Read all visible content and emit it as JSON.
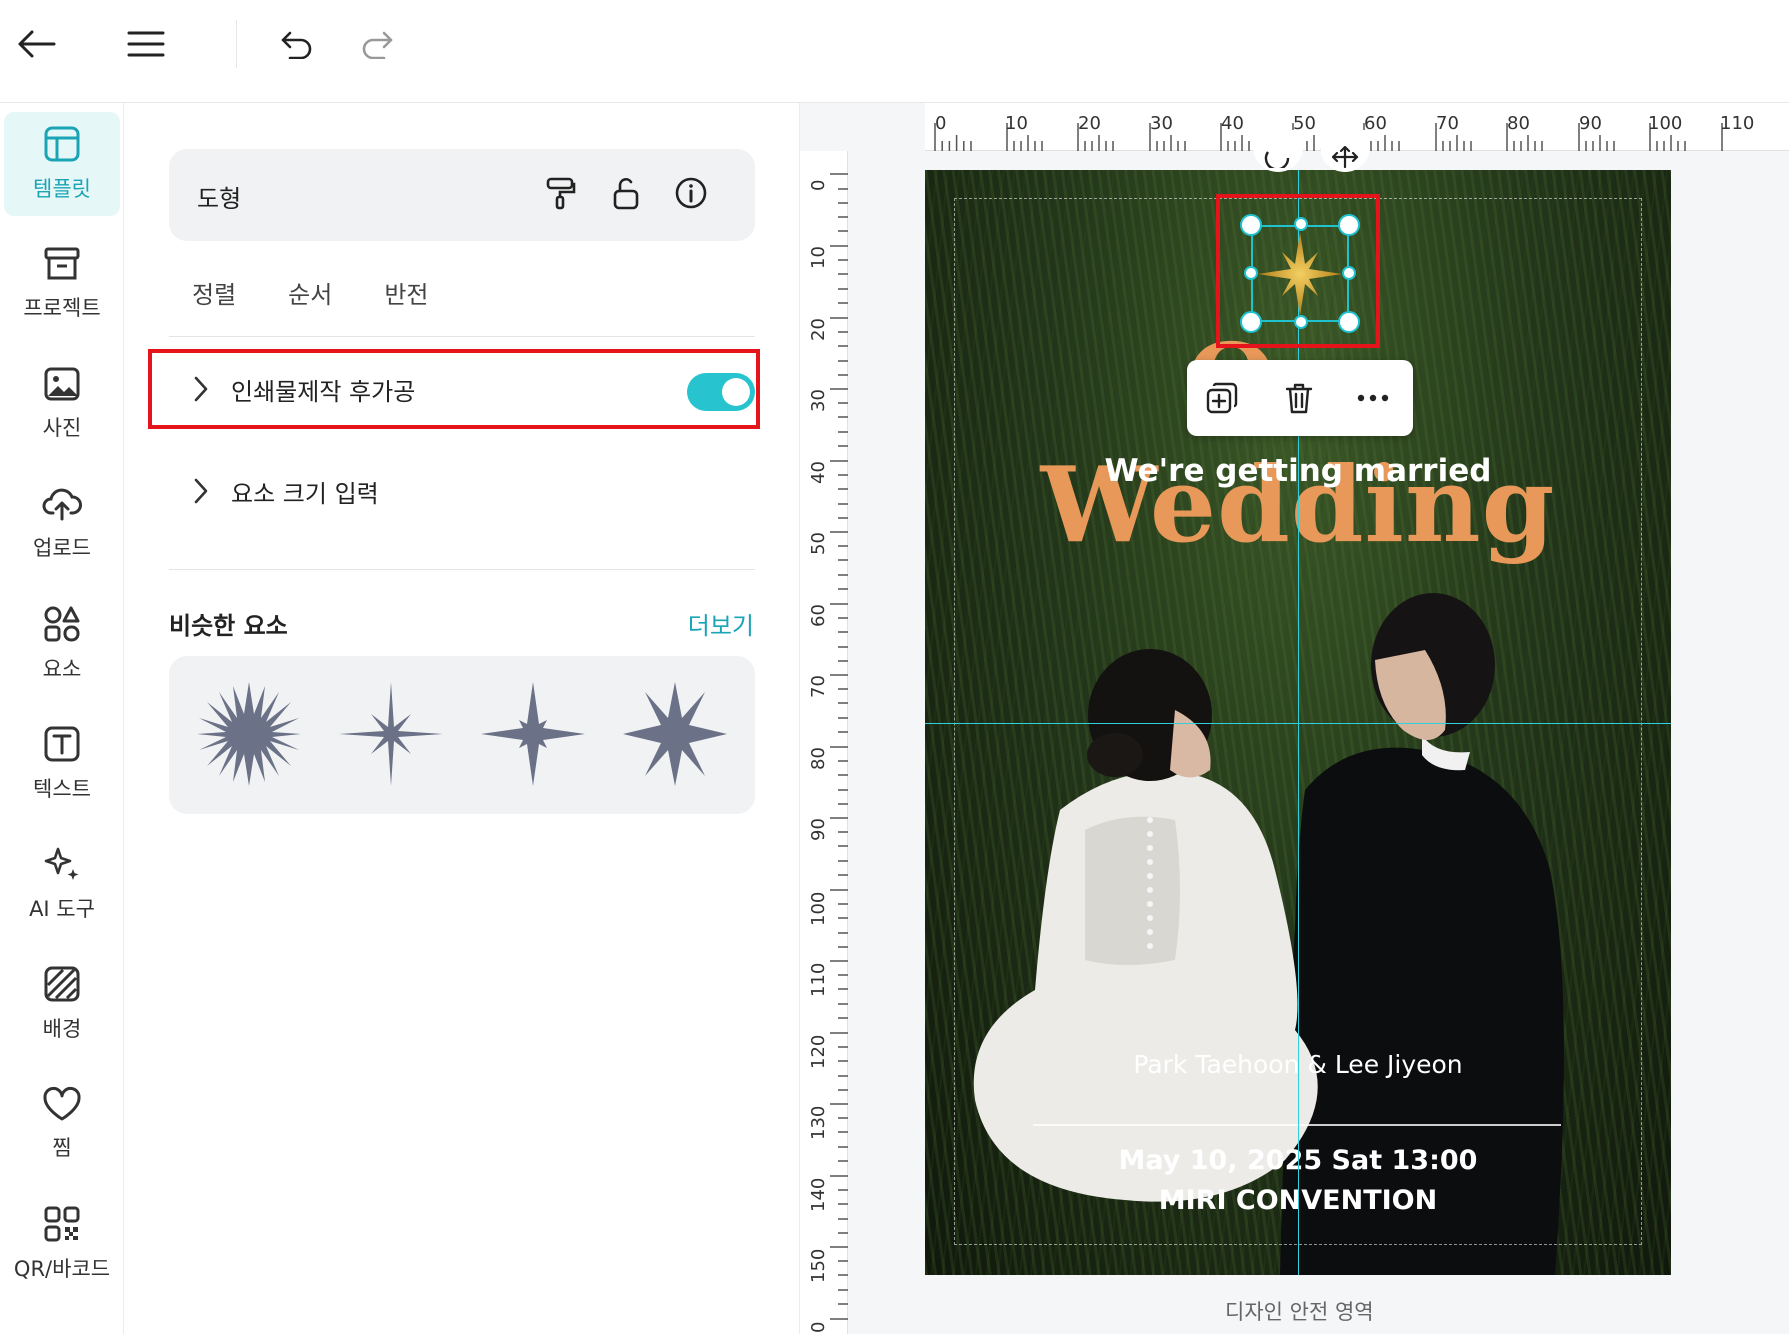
{
  "topbar": {
    "back_icon": "arrow-left-icon",
    "menu_icon": "hamburger-menu-icon",
    "undo_icon": "undo-icon",
    "redo_icon": "redo-icon"
  },
  "leftnav": {
    "items": [
      {
        "label": "템플릿",
        "icon": "template-icon"
      },
      {
        "label": "프로젝트",
        "icon": "project-icon"
      },
      {
        "label": "사진",
        "icon": "photo-icon"
      },
      {
        "label": "업로드",
        "icon": "upload-icon"
      },
      {
        "label": "요소",
        "icon": "elements-icon"
      },
      {
        "label": "텍스트",
        "icon": "text-icon"
      },
      {
        "label": "AI 도구",
        "icon": "ai-sparkle-icon"
      },
      {
        "label": "배경",
        "icon": "background-icon"
      },
      {
        "label": "찜",
        "icon": "heart-icon"
      },
      {
        "label": "QR/바코드",
        "icon": "qr-code-icon"
      }
    ]
  },
  "panel": {
    "shape_title": "도형",
    "tabs": [
      "정렬",
      "순서",
      "반전"
    ],
    "print_finish_label": "인쇄물제작 후가공",
    "print_finish_enabled": true,
    "size_input_label": "요소 크기 입력",
    "similar_title": "비슷한 요소",
    "similar_more": "더보기"
  },
  "ruler": {
    "top": [
      "0",
      "10",
      "20",
      "30",
      "40",
      "50",
      "60",
      "70",
      "80",
      "90",
      "100",
      "110"
    ],
    "left": [
      "0",
      "10",
      "20",
      "30",
      "40",
      "50",
      "60",
      "70",
      "80",
      "90",
      "100",
      "110",
      "120",
      "130",
      "140",
      "150",
      "0"
    ]
  },
  "poster": {
    "title": "Our Wedding",
    "subtitle": "We're getting married",
    "names": "Park Taehoon & Lee Jiyeon",
    "date": "May 10, 2025 Sat 13:00",
    "venue": "MIRI CONVENTION"
  },
  "canvas": {
    "safe_area_label": "디자인 안전 영역"
  },
  "colors": {
    "accent": "#27c3cf",
    "title_orange": "#e8995a",
    "highlight_red": "#e5141b",
    "star_gold": "#d9a62a",
    "shape_gray": "#6b7288"
  }
}
